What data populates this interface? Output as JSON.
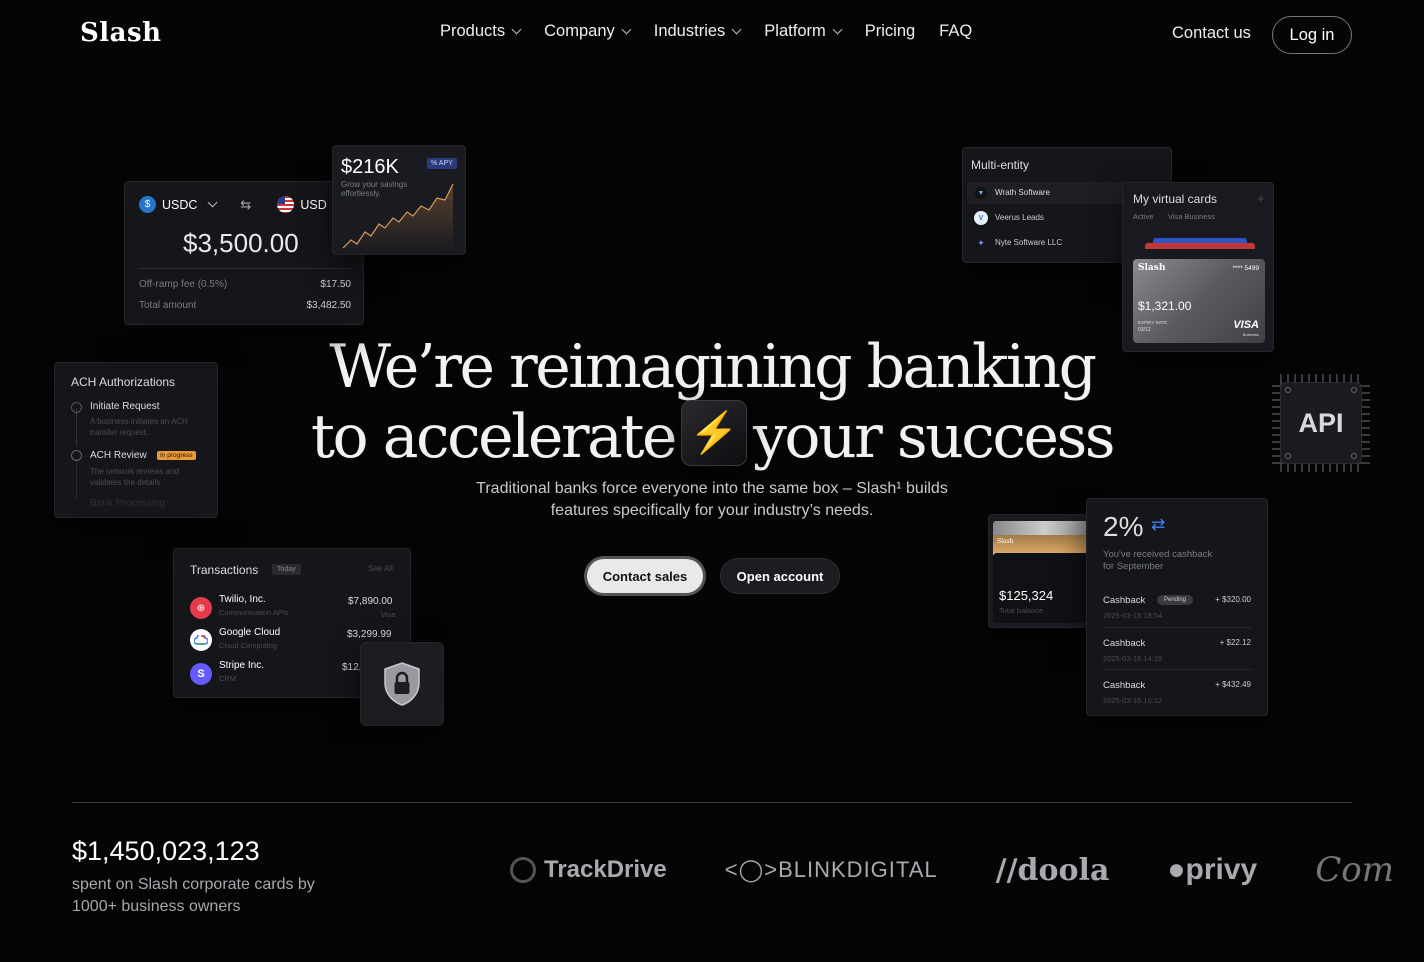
{
  "brand": {
    "logo": "Slash"
  },
  "nav": {
    "items": [
      {
        "label": "Products",
        "dropdown": true
      },
      {
        "label": "Company",
        "dropdown": true
      },
      {
        "label": "Industries",
        "dropdown": true
      },
      {
        "label": "Platform",
        "dropdown": true
      },
      {
        "label": "Pricing",
        "dropdown": false
      },
      {
        "label": "FAQ",
        "dropdown": false
      }
    ],
    "contact": "Contact us",
    "login": "Log in"
  },
  "hero": {
    "line1": "We’re reimagining banking",
    "line2a": "to accelerate",
    "line2b": "your success",
    "sub1": "Traditional banks force everyone into the same box – Slash¹ builds",
    "sub2": "features specifically for your industry’s needs.",
    "btn_sales": "Contact sales",
    "btn_open": "Open account"
  },
  "convert": {
    "from": "USDC",
    "to": "USD",
    "amount": "$3,500.00",
    "fee_label": "Off-ramp fee (0.5%)",
    "fee": "$17.50",
    "total_label": "Total amount",
    "total": "$3,482.50"
  },
  "savings": {
    "amount": "$216K",
    "badge": "% APY",
    "sub": "Grow your savings effortlessly."
  },
  "ach": {
    "title": "ACH Authorizations",
    "steps": [
      {
        "label": "Initiate Request",
        "desc": "A business initiates an ACH transfer request."
      },
      {
        "label": "ACH Review",
        "badge": "In progress",
        "desc": "The network reviews and validates the details."
      },
      {
        "label": "Bank Processing"
      }
    ]
  },
  "transactions": {
    "title": "Transactions",
    "badge": "Today",
    "see_all": "See All",
    "rows": [
      {
        "name": "Twilio, Inc.",
        "cat": "Communication APIs",
        "amount": "$7,890.00",
        "method": "Visa",
        "color": "#e33b4b"
      },
      {
        "name": "Google Cloud",
        "cat": "Cloud Computing",
        "amount": "$3,299.99",
        "method": "",
        "color": "#ffffff"
      },
      {
        "name": "Stripe Inc.",
        "cat": "CRM",
        "amount": "$12,",
        "method": "",
        "color": "#635bff",
        "initial": "S"
      }
    ]
  },
  "multi": {
    "title": "Multi-entity",
    "entities": [
      "Wrath Software",
      "Veerus Leads",
      "Nyte Software LLC"
    ]
  },
  "vcards": {
    "title": "My virtual cards",
    "status": "Active",
    "type": "Visa Business",
    "brand": "Slash",
    "last4": "**** 5499",
    "balance": "$1,321.00",
    "expiry_label": "EXPIRY DATE",
    "expiry": "03/12",
    "network": "VISA",
    "network_sub": "Business"
  },
  "api": {
    "label": "API"
  },
  "wallet": {
    "amount": "$125,324",
    "sub": "Total balance",
    "card_label": "Slash"
  },
  "cashback": {
    "rate": "2%",
    "text1": "You've received cashback",
    "text2": "for September",
    "rows": [
      {
        "label": "Cashback",
        "badge": "Pending",
        "amount": "+ $320.00",
        "date": "2025-03-15 18:54"
      },
      {
        "label": "Cashback",
        "badge": "",
        "amount": "+ $22.12",
        "date": "2025-03-15 14:28"
      },
      {
        "label": "Cashback",
        "badge": "",
        "amount": "+ $432.49",
        "date": "2025-03-15 10:12"
      }
    ]
  },
  "stats": {
    "amount": "$1,450,023,123",
    "line1": "spent on Slash corporate cards by",
    "line2": "1000+ business owners"
  },
  "logos": [
    "TrackDrive",
    "BLINKDIGITAL",
    "doola",
    "privy",
    "Com"
  ]
}
